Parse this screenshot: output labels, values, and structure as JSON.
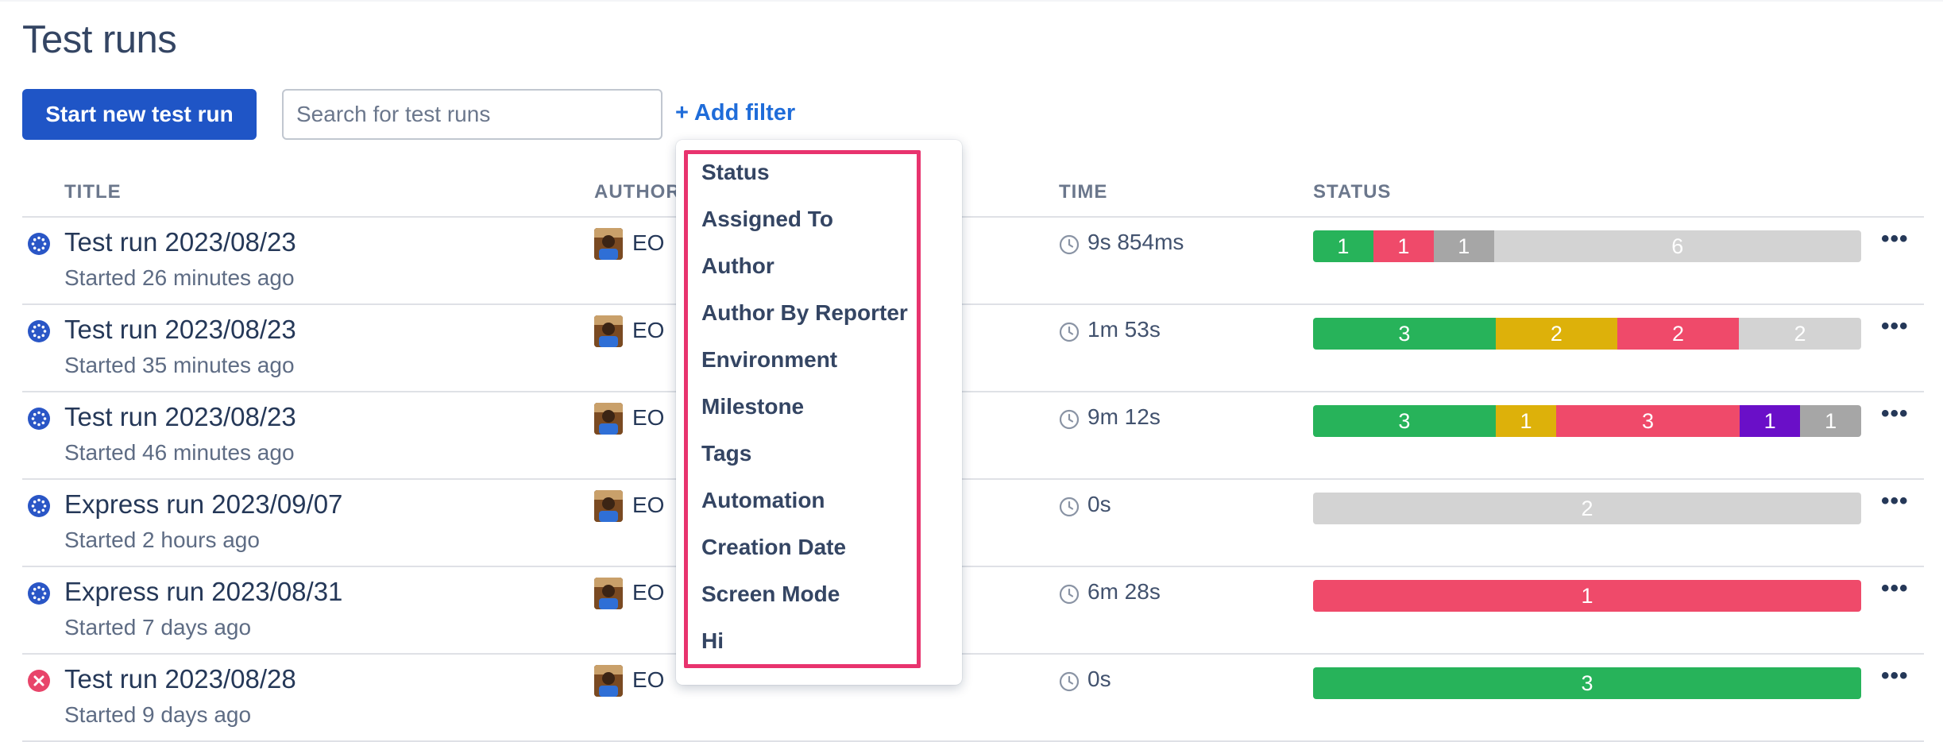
{
  "page": {
    "title": "Test runs"
  },
  "toolbar": {
    "start_button": "Start new test run",
    "search_placeholder": "Search for test runs",
    "add_filter": "+ Add filter"
  },
  "table": {
    "headers": {
      "title": "TITLE",
      "author": "AUTHOR",
      "time": "TIME",
      "status": "STATUS"
    },
    "rows": [
      {
        "title": "Test run 2023/08/23",
        "started": "Started 26 minutes ago",
        "state_icon": "running-dots-icon",
        "author": "EO",
        "time": "9s 854ms",
        "status": [
          {
            "value": "1",
            "color": "#27b35a",
            "fraction": 0.11
          },
          {
            "value": "1",
            "color": "#ef4a6a",
            "fraction": 0.11
          },
          {
            "value": "1",
            "color": "#a6a6a6",
            "fraction": 0.11
          },
          {
            "value": "6",
            "color": "#d3d3d3",
            "fraction": 0.67
          }
        ]
      },
      {
        "title": "Test run 2023/08/23",
        "started": "Started 35 minutes ago",
        "state_icon": "running-dots-icon",
        "author": "EO",
        "time": "1m 53s",
        "status": [
          {
            "value": "3",
            "color": "#27b35a",
            "fraction": 0.333
          },
          {
            "value": "2",
            "color": "#ddb10a",
            "fraction": 0.222
          },
          {
            "value": "2",
            "color": "#ef4a6a",
            "fraction": 0.222
          },
          {
            "value": "2",
            "color": "#d3d3d3",
            "fraction": 0.223
          }
        ]
      },
      {
        "title": "Test run 2023/08/23",
        "started": "Started 46 minutes ago",
        "state_icon": "running-dots-icon",
        "author": "EO",
        "time": "9m 12s",
        "status": [
          {
            "value": "3",
            "color": "#27b35a",
            "fraction": 0.333
          },
          {
            "value": "1",
            "color": "#ddb10a",
            "fraction": 0.111
          },
          {
            "value": "3",
            "color": "#ef4a6a",
            "fraction": 0.334
          },
          {
            "value": "1",
            "color": "#6a0fc8",
            "fraction": 0.111
          },
          {
            "value": "1",
            "color": "#a6a6a6",
            "fraction": 0.111
          }
        ]
      },
      {
        "title": "Express run 2023/09/07",
        "started": "Started 2 hours ago",
        "state_icon": "running-dots-icon",
        "author": "EO",
        "time": "0s",
        "status": [
          {
            "value": "2",
            "color": "#d3d3d3",
            "fraction": 1.0
          }
        ]
      },
      {
        "title": "Express run 2023/08/31",
        "started": "Started 7 days ago",
        "state_icon": "running-dots-icon",
        "author": "EO",
        "time": "6m 28s",
        "status": [
          {
            "value": "1",
            "color": "#ef4a6a",
            "fraction": 1.0
          }
        ]
      },
      {
        "title": "Test run 2023/08/28",
        "started": "Started 9 days ago",
        "state_icon": "failed-x-icon",
        "author": "EO",
        "time": "0s",
        "status": [
          {
            "value": "3",
            "color": "#27b35a",
            "fraction": 1.0
          }
        ]
      }
    ]
  },
  "filter_menu": {
    "items": [
      "Status",
      "Assigned To",
      "Author",
      "Author By Reporter",
      "Environment",
      "Milestone",
      "Tags",
      "Automation",
      "Creation Date",
      "Screen Mode",
      "Hi"
    ],
    "highlight_color": "#e8336e"
  },
  "colors": {
    "primary": "#1f55c6",
    "link": "#1f6cd9",
    "running_icon": "#2a56c6",
    "failed_icon": "#e8456a"
  }
}
